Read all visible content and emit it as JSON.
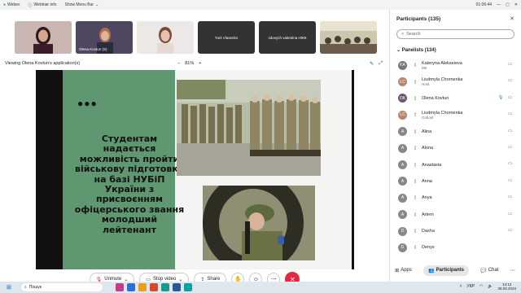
{
  "topbar": {
    "webex": "Webex",
    "webinar_info": "Webinar info",
    "show_menu_bar": "Show Menu Bar",
    "timer": "01:06:44"
  },
  "strip": {
    "tiles": [
      {
        "name": ""
      },
      {
        "name": "Olena Kovtun (S)"
      },
      {
        "name": ""
      },
      {
        "name": "Yurii Vlasenko"
      },
      {
        "name": "vdovych valentina НЖК"
      },
      {
        "name": ""
      }
    ]
  },
  "view": {
    "viewing": "Viewing Olena Kovtun's application(s)",
    "zoom": "81%"
  },
  "slide": {
    "dots": "●●●",
    "text": "Студентам надається можливість пройти військову підготовку на базі НУБіП України з присвоєнням офіцерського звання молодший лейтенант"
  },
  "controls": {
    "unmute": "Unmute",
    "stop_video": "Stop video",
    "share": "Share"
  },
  "panel": {
    "header": "Participants (135)",
    "search_placeholder": "Search",
    "panelists_header": "Panelists (134)",
    "participants": [
      {
        "initials": "KA",
        "name": "Kateryna Alekseieva",
        "role": "Me"
      },
      {
        "initials": "LC",
        "name": "Liudmyla Chornenka",
        "role": "Host"
      },
      {
        "initials": "OK",
        "name": "Olena Kovtun",
        "role": ""
      },
      {
        "initials": "LC",
        "name": "Liudmyla Chornenka",
        "role": "Cohost"
      },
      {
        "initials": "A",
        "name": "Alina",
        "role": ""
      },
      {
        "initials": "A",
        "name": "Alona",
        "role": ""
      },
      {
        "initials": "A",
        "name": "Anastasia",
        "role": ""
      },
      {
        "initials": "A",
        "name": "Anna",
        "role": ""
      },
      {
        "initials": "A",
        "name": "Anya",
        "role": ""
      },
      {
        "initials": "A",
        "name": "Artem",
        "role": ""
      },
      {
        "initials": "D",
        "name": "Dasha",
        "role": ""
      },
      {
        "initials": "D",
        "name": "Denys",
        "role": ""
      }
    ],
    "tabs": {
      "apps": "Apps",
      "participants": "Participants",
      "chat": "Chat"
    }
  },
  "taskbar": {
    "search": "Пошук",
    "lang": "УКР",
    "time": "14:12",
    "date": "28.02.2023"
  }
}
